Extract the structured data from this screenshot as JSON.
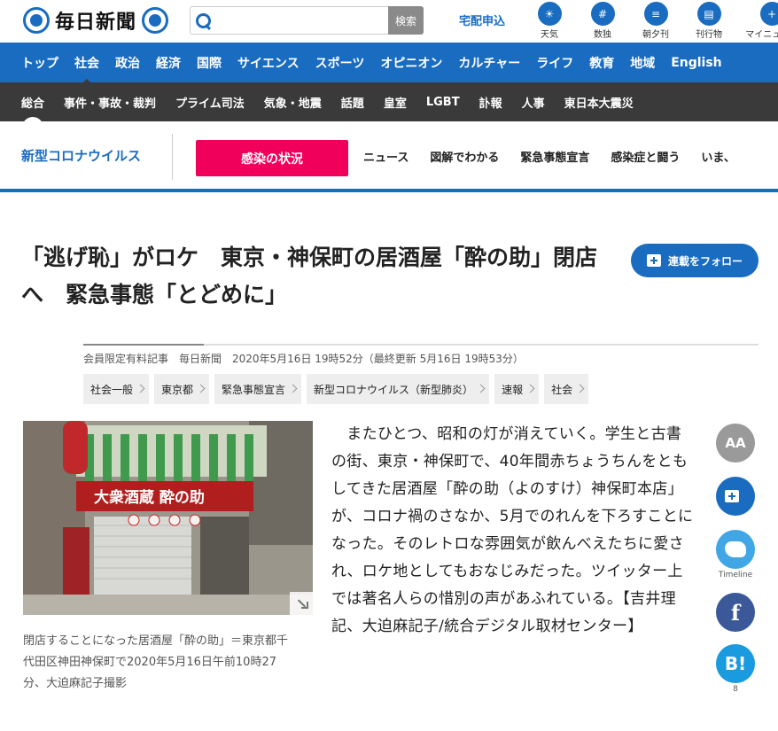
{
  "header": {
    "logo_text": "毎日新聞",
    "search_button": "検索",
    "search_placeholder": "",
    "delivery_link": "宅配申込",
    "icons": [
      {
        "icon": "weather-icon",
        "label": "天気"
      },
      {
        "icon": "numbers-icon",
        "label": "数独"
      },
      {
        "icon": "morning-evening-icon",
        "label": "朝夕刊"
      },
      {
        "icon": "publications-icon",
        "label": "刊行物"
      },
      {
        "icon": "my-news-icon",
        "label": "マイニュース"
      }
    ]
  },
  "nav_primary": [
    "トップ",
    "社会",
    "政治",
    "経済",
    "国際",
    "サイエンス",
    "スポーツ",
    "オピニオン",
    "カルチャー",
    "ライフ",
    "教育",
    "地域",
    "English"
  ],
  "nav_primary_active": "社会",
  "nav_secondary": [
    "総合",
    "事件・事故・裁判",
    "プライム司法",
    "気象・地震",
    "話題",
    "皇室",
    "LGBT",
    "訃報",
    "人事",
    "東日本大震災"
  ],
  "nav_secondary_active": "総合",
  "corona_bar": {
    "title": "新型コロナウイルス",
    "button": "感染の状況",
    "links": [
      "ニュース",
      "図解でわかる",
      "緊急事態宣言",
      "感染症と闘う",
      "いま、"
    ]
  },
  "article": {
    "headline": "「逃げ恥」がロケ　東京・神保町の居酒屋「酔の助」閉店へ　緊急事態「とどめに」",
    "follow_button": "連載をフォロー",
    "meta": "会員限定有料記事　毎日新聞　2020年5月16日 19時52分（最終更新 5月16日 19時53分）",
    "tags": [
      "社会一般",
      "東京都",
      "緊急事態宣言",
      "新型コロナウイルス（新型肺炎）",
      "速報",
      "社会"
    ],
    "photo_caption": "閉店することになった居酒屋「酔の助」＝東京都千代田区神田神保町で2020年5月16日午前10時27分、大迫麻記子撮影",
    "photo_sign_text": "大衆酒蔵 酔の助",
    "body": "　またひとつ、昭和の灯が消えていく。学生と古書の街、東京・神保町で、40年間赤ちょうちんをともしてきた居酒屋「酔の助（よのすけ）神保町本店」が、コロナ禍のさなか、5月でのれんを下ろすことになった。そのレトロな雰囲気が飲んべえたちに愛され、ロケ地としてもおなじみだった。ツイッター上では著名人らの惜別の声があふれている。【吉井理記、大迫麻記子/統合デジタル取材センター】"
  },
  "share": {
    "font_size_label": "AA",
    "twitter_label": "Timeline",
    "facebook_label": "f",
    "hatena_label": "B!",
    "hatena_count": "8"
  },
  "colors": {
    "brand_blue": "#1a6cc0",
    "nav_dark": "#3a3a3a",
    "corona_pink": "#f0005b",
    "twitter": "#41a6e6",
    "facebook": "#3b5998"
  }
}
